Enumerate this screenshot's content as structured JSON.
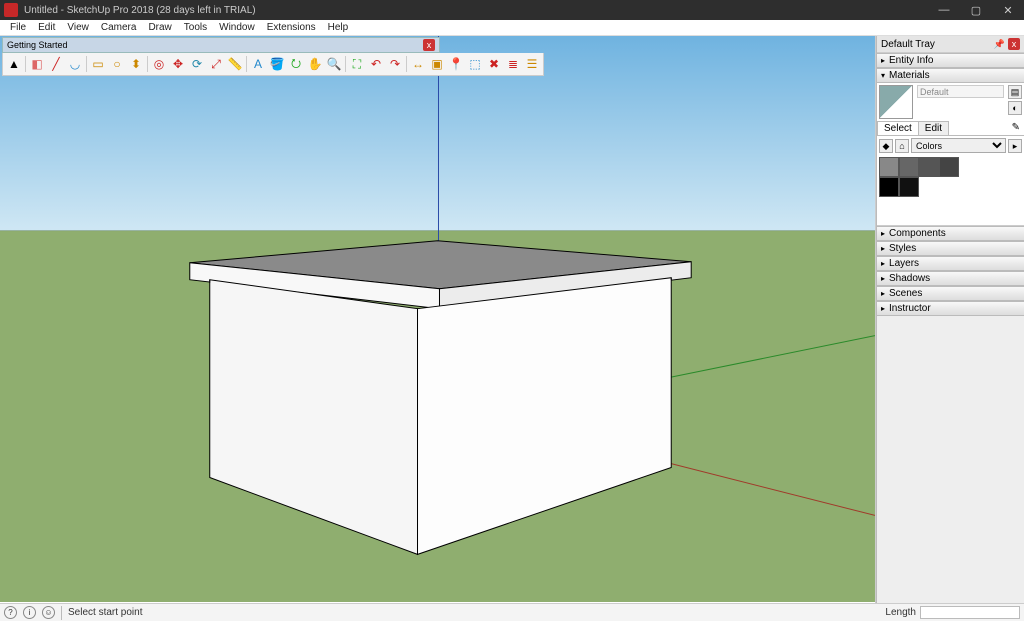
{
  "titlebar": {
    "title": "Untitled - SketchUp Pro 2018 (28 days left in TRIAL)"
  },
  "win_buttons": {
    "min": "—",
    "max": "▢",
    "close": "✕"
  },
  "menu": [
    "File",
    "Edit",
    "View",
    "Camera",
    "Draw",
    "Tools",
    "Window",
    "Extensions",
    "Help"
  ],
  "toolbar": {
    "title": "Getting Started",
    "close": "x",
    "icons": [
      "select",
      "eraser",
      "line",
      "arc",
      "rect",
      "circle",
      "pushpull",
      "offset",
      "move",
      "rotate",
      "scale",
      "tape",
      "text",
      "paint",
      "orbit",
      "pan",
      "zoom",
      "zoom-extents",
      "undo",
      "redo",
      "dim",
      "section",
      "addloc",
      "3dw",
      "ext",
      "layers",
      "outliner"
    ]
  },
  "tray": {
    "title": "Default Tray",
    "pin": "📌",
    "close": "x",
    "panels_top": [
      {
        "label": "Entity Info",
        "expanded": false
      },
      {
        "label": "Materials",
        "expanded": true
      }
    ],
    "materials": {
      "name_placeholder": "Default",
      "tabs": {
        "select": "Select",
        "edit": "Edit"
      },
      "dropdown": "Colors",
      "swatches": [
        "#888888",
        "#666666",
        "#555555",
        "#444444",
        "#000000",
        "#111111"
      ]
    },
    "panels_bottom": [
      {
        "label": "Components"
      },
      {
        "label": "Styles"
      },
      {
        "label": "Layers"
      },
      {
        "label": "Shadows"
      },
      {
        "label": "Scenes"
      },
      {
        "label": "Instructor"
      }
    ]
  },
  "status": {
    "hint": "Select start point",
    "length_label": "Length"
  }
}
